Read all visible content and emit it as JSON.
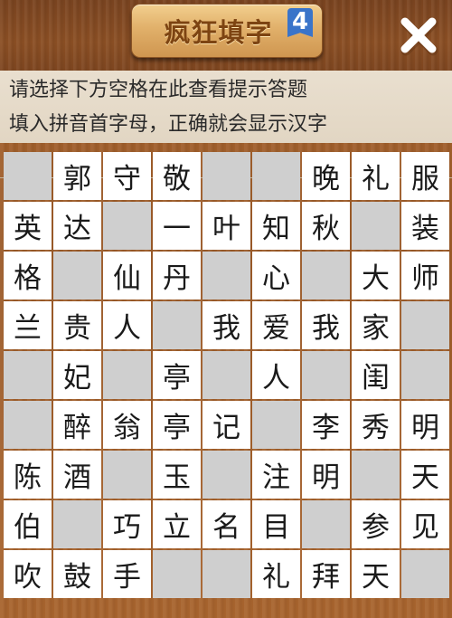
{
  "header": {
    "title": "疯狂填字",
    "badge": "4",
    "close_icon": "close-x-icon"
  },
  "hints": {
    "line1": "请选择下方空格在此查看提示答题",
    "line2": "填入拼音首字母，正确就会显示汉字"
  },
  "colors": {
    "cell_white": "#ffffff",
    "cell_blank": "#cfcfcf",
    "wood": "#9a5a28"
  },
  "grid": {
    "rows": [
      [
        "",
        "郭",
        "守",
        "敬",
        "",
        "",
        "晚",
        "礼",
        "服"
      ],
      [
        "英",
        "达",
        "",
        "一",
        "叶",
        "知",
        "秋",
        "",
        "装"
      ],
      [
        "格",
        "",
        "仙",
        "丹",
        "",
        "心",
        "",
        "大",
        "师"
      ],
      [
        "兰",
        "贵",
        "人",
        "",
        "我",
        "爱",
        "我",
        "家",
        ""
      ],
      [
        "",
        "妃",
        "",
        "亭",
        "",
        "人",
        "",
        "闺",
        ""
      ],
      [
        "",
        "醉",
        "翁",
        "亭",
        "记",
        "",
        "李",
        "秀",
        "明"
      ],
      [
        "陈",
        "酒",
        "",
        "玉",
        "",
        "注",
        "明",
        "",
        "天"
      ],
      [
        "伯",
        "",
        "巧",
        "立",
        "名",
        "目",
        "",
        "参",
        "见"
      ],
      [
        "吹",
        "鼓",
        "手",
        "",
        "",
        "礼",
        "拜",
        "天",
        ""
      ]
    ],
    "cell_types": [
      [
        "blank",
        "white",
        "white",
        "white",
        "blank",
        "blank",
        "white",
        "white",
        "white"
      ],
      [
        "white",
        "white",
        "blank",
        "white",
        "white",
        "white",
        "white",
        "blank",
        "white"
      ],
      [
        "white",
        "blank",
        "white",
        "white",
        "blank",
        "white",
        "blank",
        "white",
        "white"
      ],
      [
        "white",
        "white",
        "white",
        "blank",
        "white",
        "white",
        "white",
        "white",
        "blank"
      ],
      [
        "blank",
        "white",
        "blank",
        "white",
        "blank",
        "white",
        "blank",
        "white",
        "blank"
      ],
      [
        "blank",
        "white",
        "white",
        "white",
        "white",
        "blank",
        "white",
        "white",
        "white"
      ],
      [
        "white",
        "white",
        "blank",
        "white",
        "blank",
        "white",
        "white",
        "blank",
        "white"
      ],
      [
        "white",
        "blank",
        "white",
        "white",
        "white",
        "white",
        "blank",
        "white",
        "white"
      ],
      [
        "white",
        "white",
        "white",
        "blank",
        "blank",
        "white",
        "white",
        "white",
        "blank"
      ]
    ]
  }
}
